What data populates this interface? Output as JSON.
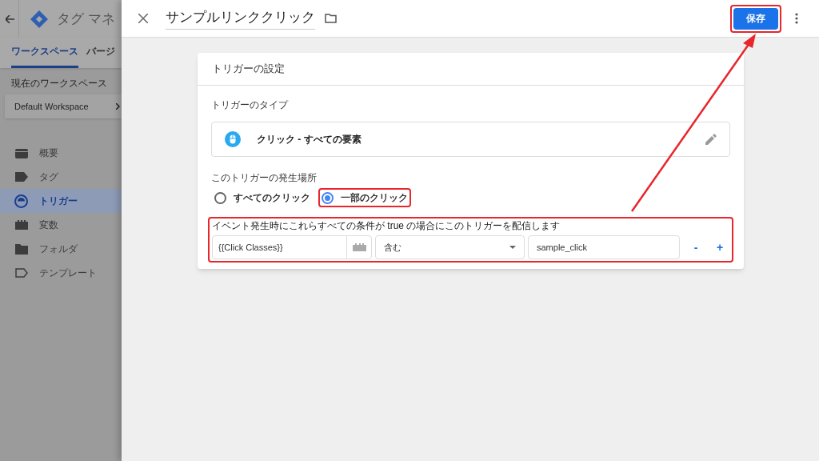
{
  "background_app": {
    "title": "タグ マネ",
    "tabs": [
      {
        "label": "ワークスペース",
        "selected": true
      },
      {
        "label": "バージ",
        "selected": false
      }
    ],
    "workspace_label": "現在のワークスペース",
    "workspace": "Default Workspace",
    "nav": [
      {
        "label": "概要",
        "kind": "overview",
        "selected": false
      },
      {
        "label": "タグ",
        "kind": "tag",
        "selected": false
      },
      {
        "label": "トリガー",
        "kind": "trigger",
        "selected": true
      },
      {
        "label": "変数",
        "kind": "variable",
        "selected": false
      },
      {
        "label": "フォルダ",
        "kind": "folder",
        "selected": false
      },
      {
        "label": "テンプレート",
        "kind": "template",
        "selected": false
      }
    ]
  },
  "panel": {
    "title": "サンプルリンククリック",
    "save": {
      "label": "保存",
      "annotated": true
    }
  },
  "card": {
    "title": "トリガーの設定",
    "type_label": "トリガーのタイプ",
    "type_name": "クリック - すべての要素",
    "fire_label": "このトリガーの発生場所",
    "options": [
      {
        "label": "すべてのクリック",
        "selected": false,
        "annotated": false
      },
      {
        "label": "一部のクリック",
        "selected": true,
        "annotated": true
      }
    ],
    "conditions": {
      "annotated": true,
      "text": "イベント発生時にこれらすべての条件が true の場合にこのトリガーを配信します",
      "variable": "{{Click Classes}}",
      "operator": "含む",
      "value": "sample_click",
      "remove": "-",
      "add": "+"
    }
  }
}
